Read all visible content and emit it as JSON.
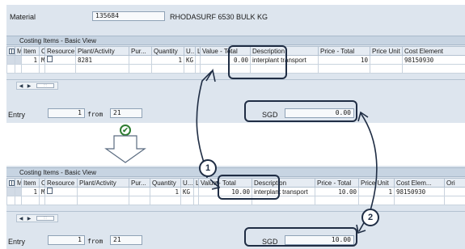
{
  "top": {
    "material_label": "Material",
    "material_number": "135684",
    "material_desc": "RHODASURF 6530 BULK KG",
    "table_title": "Costing Items - Basic View",
    "columns": [
      "M",
      "Item",
      "C",
      "Resource",
      "Plant/Activity",
      "Pur...",
      "Quantity",
      "U...",
      "L",
      "Value - Total",
      "Description",
      "Price - Total",
      "Price Unit",
      "Cost Element"
    ],
    "row": {
      "item": "1",
      "category": "M",
      "plant_activity": "8281",
      "quantity": "1",
      "unit": "KG",
      "value_total": "0.00",
      "description": "interplant transport",
      "price_total": "10",
      "price_unit": "",
      "cost_element": "98150930"
    },
    "entry_label": "Entry",
    "entry_value": "1",
    "from_label": "from",
    "from_value": "21",
    "currency": "SGD",
    "total": "0.00"
  },
  "bottom": {
    "table_title": "Costing Items - Basic View",
    "columns": [
      "M",
      "Item",
      "C",
      "Resource",
      "Plant/Activity",
      "Pur...",
      "Quantity",
      "U...",
      "L",
      "Value - Total",
      "Description",
      "Price - Total",
      "Price Unit",
      "Cost Elem...",
      "Ori"
    ],
    "row": {
      "item": "1",
      "category": "M",
      "quantity": "1",
      "unit": "KG",
      "value_total": "10.00",
      "description": "interplant transport",
      "price_total": "10.00",
      "price_unit": "1",
      "cost_element": "98150930"
    },
    "entry_label": "Entry",
    "entry_value": "1",
    "from_label": "from",
    "from_value": "21",
    "currency": "SGD",
    "total": "10.00"
  },
  "callouts": {
    "one": "1",
    "two": "2"
  },
  "colors": {
    "panel": "#dde5ee",
    "highlight": "#1f2d44",
    "check": "#2e7d32"
  }
}
